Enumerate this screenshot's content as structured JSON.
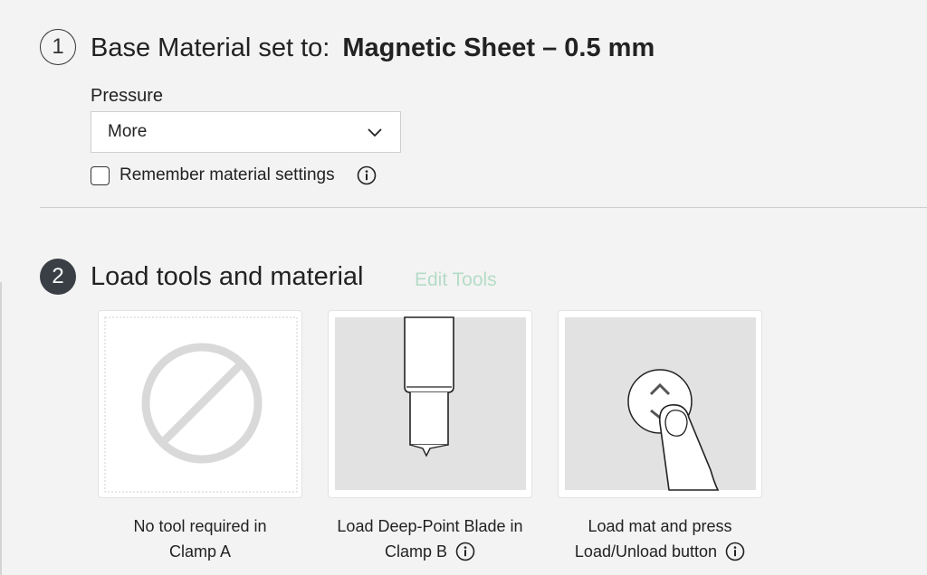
{
  "step1": {
    "number": "1",
    "title_prefix": "Base Material set to:",
    "material": "Magnetic Sheet – 0.5 mm",
    "pressure_label": "Pressure",
    "pressure_value": "More",
    "remember_label": "Remember material settings",
    "remember_checked": false
  },
  "step2": {
    "number": "2",
    "title": "Load tools and material",
    "edit_tools": "Edit Tools",
    "cards": [
      {
        "line1": "No tool required in",
        "line2": "Clamp A",
        "icon": "no-tool-icon"
      },
      {
        "line1": "Load Deep-Point Blade in",
        "line2": "Clamp B",
        "icon": "deep-point-blade-icon"
      },
      {
        "line1": "Load mat and press",
        "line2": "Load/Unload button",
        "icon": "load-unload-button-icon"
      }
    ]
  },
  "colors": {
    "background": "#f3f3f3",
    "active_step": "#3a3f46",
    "edit_tools_link": "#b5dcc6"
  }
}
